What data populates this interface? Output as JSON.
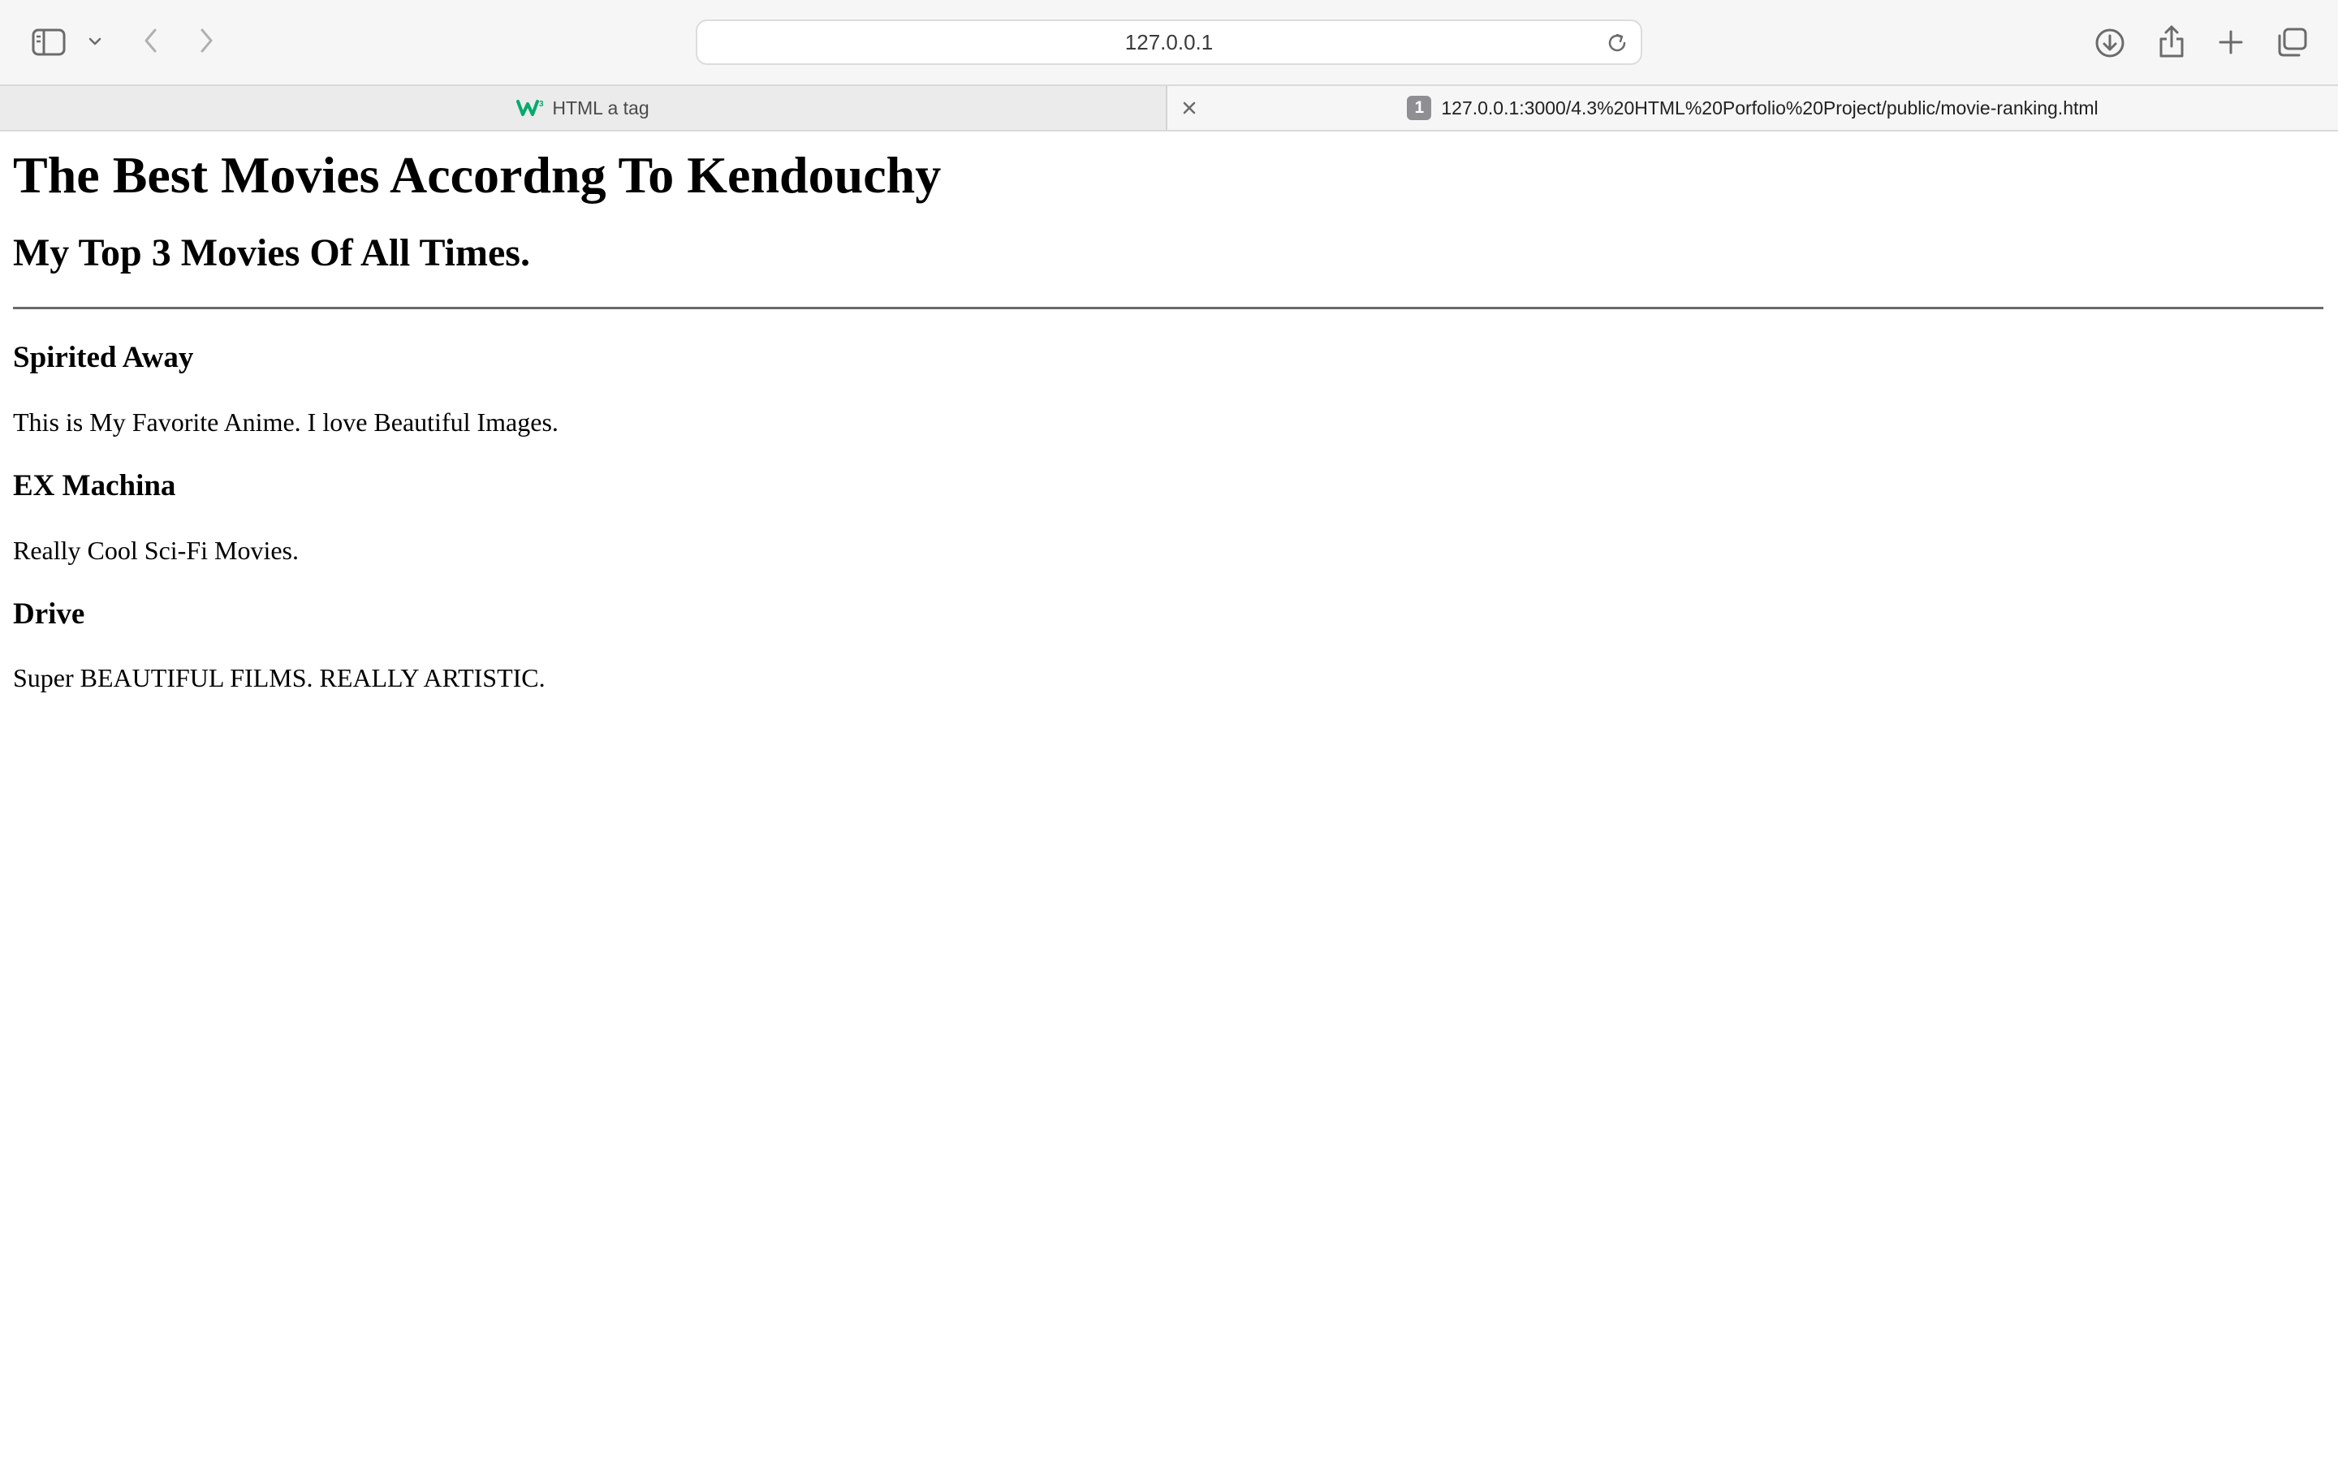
{
  "browser": {
    "address": "127.0.0.1",
    "tabs": [
      {
        "label": "HTML a tag",
        "favicon": "w3schools-icon",
        "active": false
      },
      {
        "label": "127.0.0.1:3000/4.3%20HTML%20Porfolio%20Project/public/movie-ranking.html",
        "badge": "1",
        "active": true
      }
    ]
  },
  "page": {
    "title": "The Best Movies Accordng To Kendouchy",
    "subtitle": "My Top 3 Movies Of All Times.",
    "movies": [
      {
        "name": "Spirited Away",
        "description": "This is My Favorite Anime. I love Beautiful Images."
      },
      {
        "name": "EX Machina",
        "description": "Really Cool Sci-Fi Movies."
      },
      {
        "name": "Drive",
        "description": "Super BEAUTIFUL FILMS. REALLY ARTISTIC."
      }
    ]
  },
  "colors": {
    "toolbar": "#f6f6f6",
    "favicon_green": "#04aa6d"
  }
}
